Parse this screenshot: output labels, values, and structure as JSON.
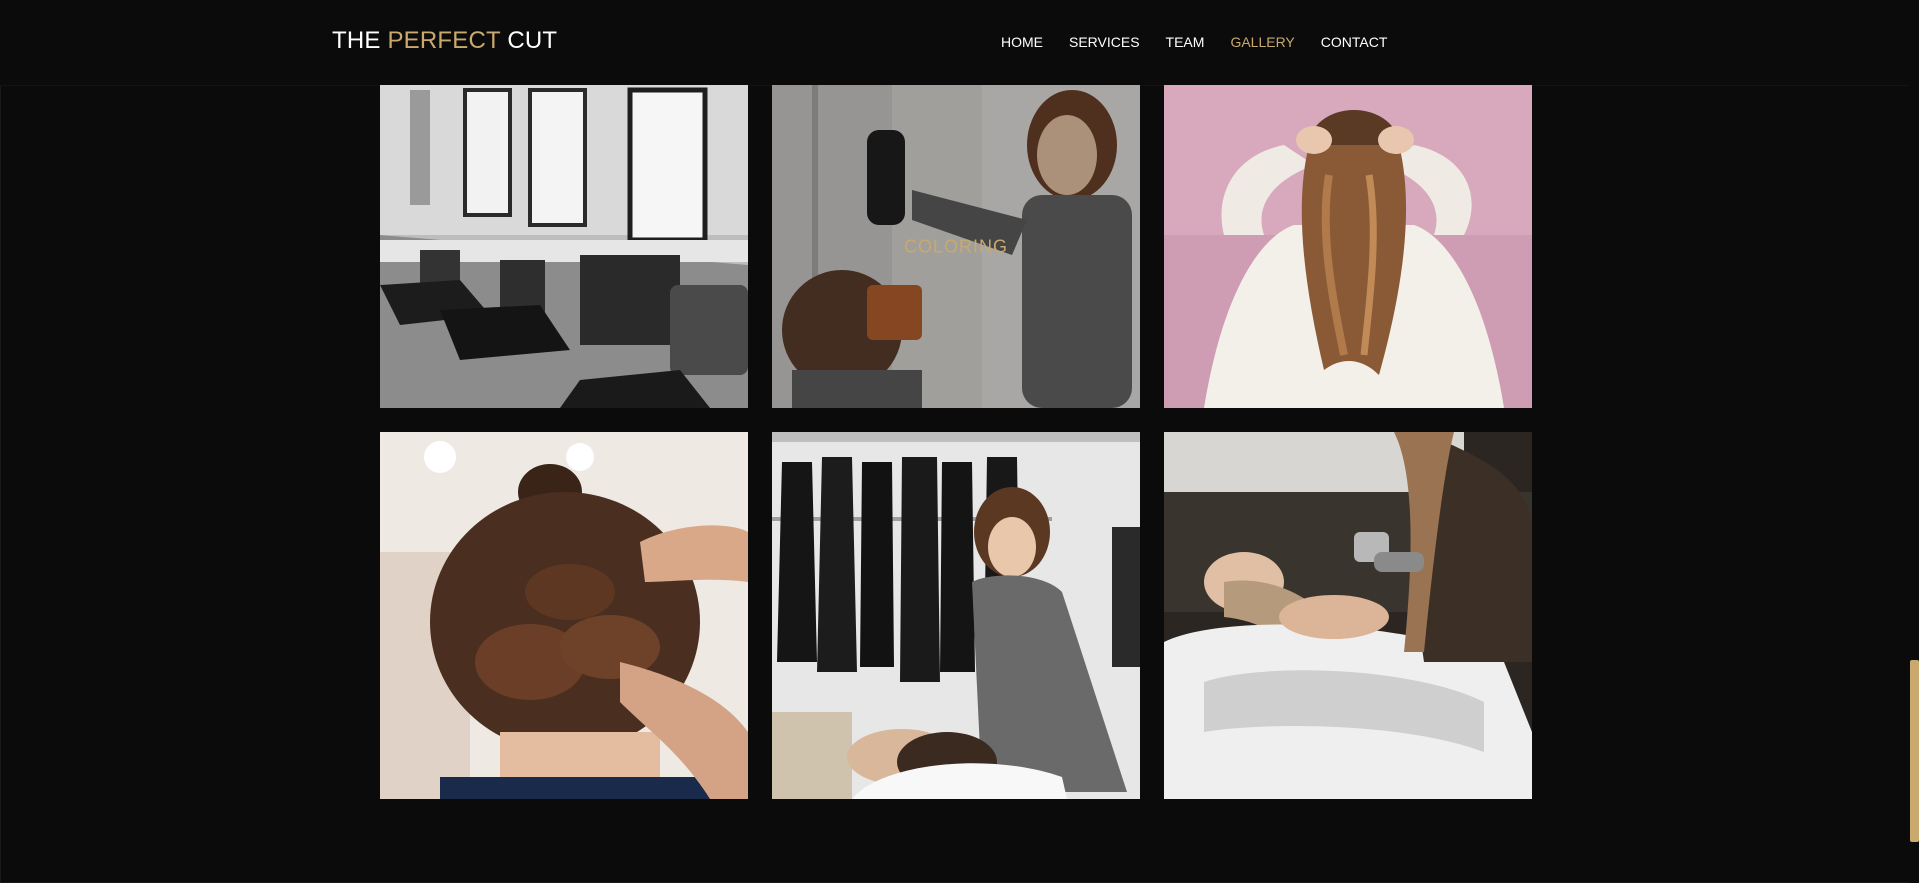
{
  "header": {
    "logo": {
      "part1": "THE ",
      "part2": "PERFECT",
      "part3": " CUT"
    },
    "nav": [
      {
        "label": "HOME",
        "active": false
      },
      {
        "label": "SERVICES",
        "active": false
      },
      {
        "label": "TEAM",
        "active": false
      },
      {
        "label": "GALLERY",
        "active": true
      },
      {
        "label": "CONTACT",
        "active": false
      }
    ]
  },
  "gallery": {
    "hover_caption": "COLORING"
  },
  "colors": {
    "background": "#0b0b0b",
    "accent": "#c9a96e",
    "text": "#ffffff"
  }
}
